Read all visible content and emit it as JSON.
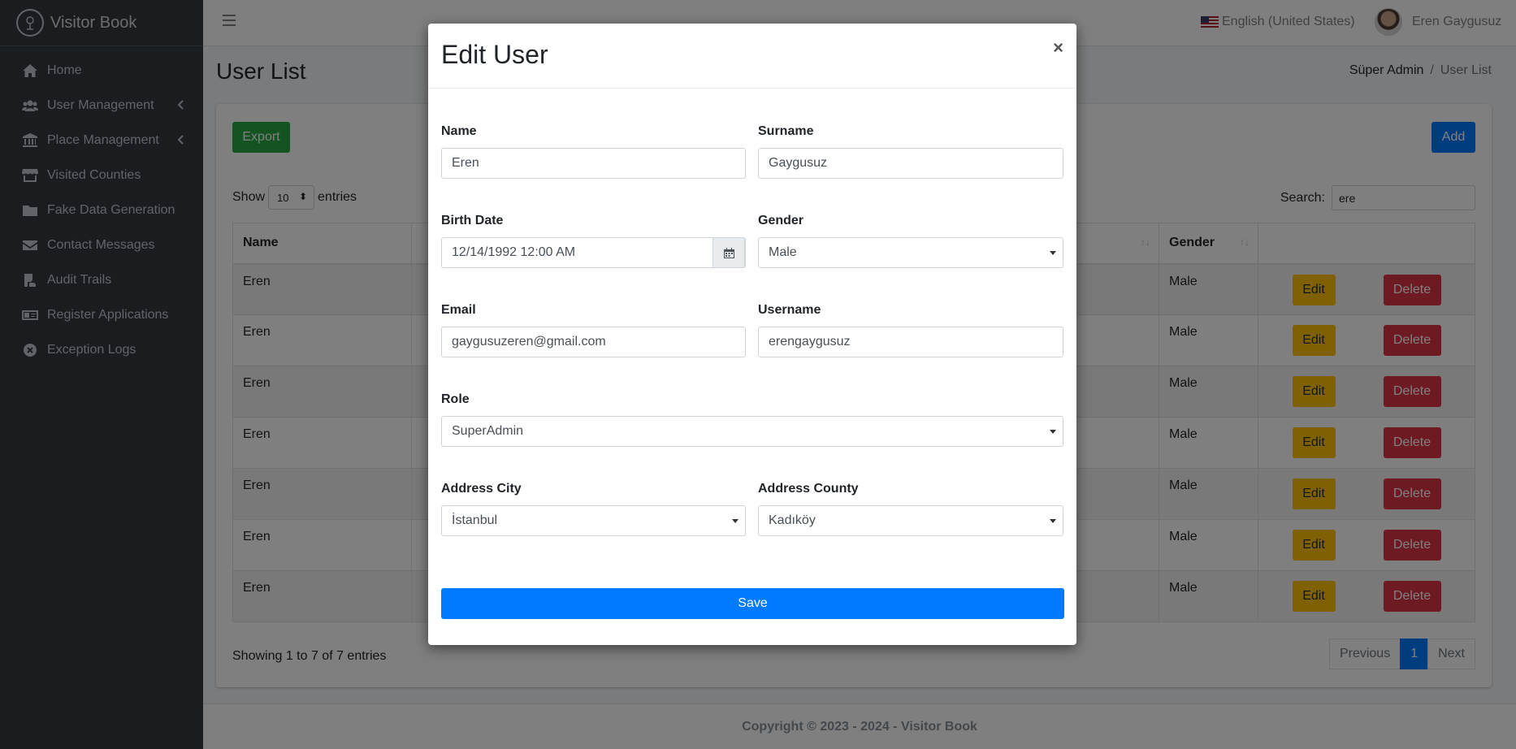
{
  "app": {
    "name": "Visitor Book"
  },
  "sidebar": {
    "items": [
      {
        "label": "Home",
        "icon": "home-icon"
      },
      {
        "label": "User Management",
        "icon": "users-icon"
      },
      {
        "label": "Place Management",
        "icon": "landmark-icon"
      },
      {
        "label": "Visited Counties",
        "icon": "store-icon"
      },
      {
        "label": "Fake Data Generation",
        "icon": "folder-icon"
      },
      {
        "label": "Contact Messages",
        "icon": "envelope-icon"
      },
      {
        "label": "Audit Trails",
        "icon": "audit-icon"
      },
      {
        "label": "Register Applications",
        "icon": "id-card-icon"
      },
      {
        "label": "Exception Logs",
        "icon": "times-circle-icon"
      }
    ]
  },
  "topbar": {
    "language": "English (United States)",
    "user_name": "Eren Gaygusuz"
  },
  "page": {
    "title": "User List",
    "breadcrumb": [
      "Süper Admin",
      "User List"
    ],
    "sep": "/"
  },
  "toolbar": {
    "export_label": "Export",
    "add_label": "Add"
  },
  "table": {
    "show_label": "Show",
    "entries_label": "entries",
    "page_size": "10",
    "search_label": "Search:",
    "search_value": "ere",
    "headers": {
      "name": "Name",
      "gender": "Gender"
    },
    "rows": [
      {
        "name": "Eren",
        "gender": "Male"
      },
      {
        "name": "Eren",
        "gender": "Male"
      },
      {
        "name": "Eren",
        "gender": "Male"
      },
      {
        "name": "Eren",
        "gender": "Male"
      },
      {
        "name": "Eren",
        "gender": "Male"
      },
      {
        "name": "Eren",
        "gender": "Male"
      },
      {
        "name": "Eren",
        "gender": "Male"
      }
    ],
    "edit_label": "Edit",
    "delete_label": "Delete",
    "info": "Showing 1 to 7 of 7 entries",
    "pagination": {
      "previous": "Previous",
      "current": "1",
      "next": "Next"
    }
  },
  "footer": {
    "copyright": "Copyright © 2023 - 2024 - Visitor Book"
  },
  "modal": {
    "title": "Edit User",
    "close": "×",
    "fields": {
      "name": {
        "label": "Name",
        "value": "Eren"
      },
      "surname": {
        "label": "Surname",
        "value": "Gaygusuz"
      },
      "birth_date": {
        "label": "Birth Date",
        "value": "12/14/1992 12:00 AM"
      },
      "gender": {
        "label": "Gender",
        "value": "Male"
      },
      "email": {
        "label": "Email",
        "value": "gaygusuzeren@gmail.com"
      },
      "username": {
        "label": "Username",
        "value": "erengaygusuz"
      },
      "role": {
        "label": "Role",
        "value": "SuperAdmin"
      },
      "city": {
        "label": "Address City",
        "value": "İstanbul"
      },
      "county": {
        "label": "Address County",
        "value": "Kadıköy"
      }
    },
    "save_label": "Save"
  },
  "colors": {
    "sidebar_bg": "#343a40",
    "primary": "#007bff",
    "success": "#28a745",
    "warning": "#ffc107",
    "danger": "#dc3545"
  }
}
